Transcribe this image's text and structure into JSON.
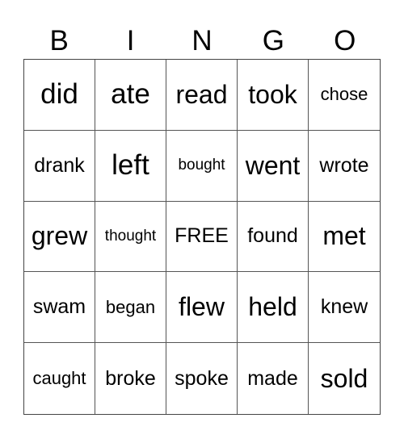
{
  "header": {
    "letters": [
      "B",
      "I",
      "N",
      "G",
      "O"
    ]
  },
  "card": {
    "rows": [
      [
        "did",
        "ate",
        "read",
        "took",
        "chose"
      ],
      [
        "drank",
        "left",
        "bought",
        "went",
        "wrote"
      ],
      [
        "grew",
        "thought",
        "FREE",
        "found",
        "met"
      ],
      [
        "swam",
        "began",
        "flew",
        "held",
        "knew"
      ],
      [
        "caught",
        "broke",
        "spoke",
        "made",
        "sold"
      ]
    ],
    "free_label": "FREE"
  }
}
